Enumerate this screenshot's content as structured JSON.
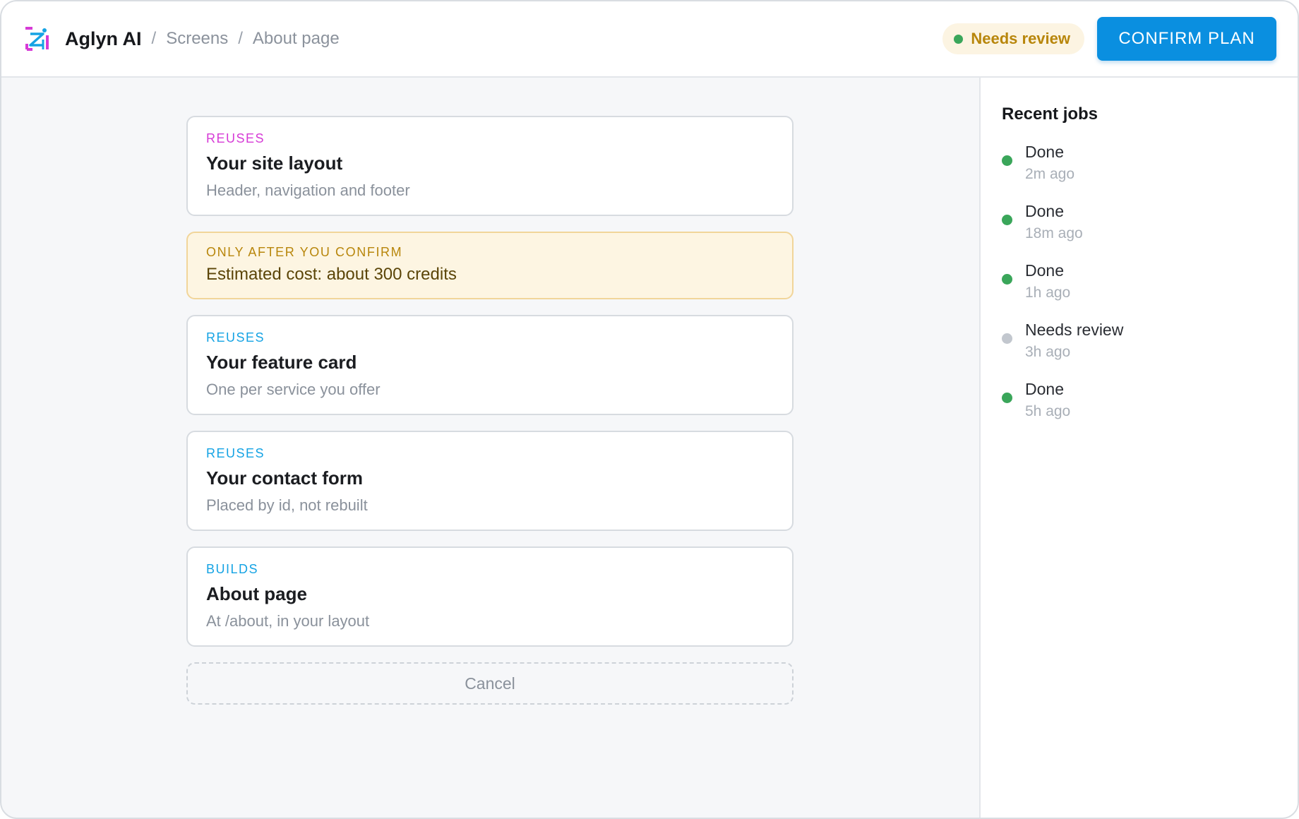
{
  "header": {
    "brand": "Aglyn AI",
    "breadcrumb": [
      {
        "label": "Screens"
      },
      {
        "label": "About page"
      }
    ],
    "separator": "/",
    "status": {
      "label": "Needs review",
      "dot_color": "#3aa65a"
    },
    "confirm_label": "CONFIRM PLAN",
    "accent": "#0a8fe0"
  },
  "cards": [
    {
      "tag": "REUSES",
      "title": "Your site layout",
      "subtitle": "Header, navigation and footer",
      "tag_color": "#d63bd6"
    },
    {
      "tag": "ONLY AFTER YOU CONFIRM",
      "text": "Estimated cost: about 300 credits"
    },
    {
      "tag": "REUSES",
      "title": "Your feature card",
      "subtitle": "One per service you offer",
      "tag_color": "#15a3e4"
    },
    {
      "tag": "REUSES",
      "title": "Your contact form",
      "subtitle": "Placed by id, not rebuilt",
      "tag_color": "#15a3e4"
    },
    {
      "tag": "BUILDS",
      "title": "About page",
      "subtitle": "At /about, in your layout",
      "tag_color": "#15a3e4"
    }
  ],
  "cancel_label": "Cancel",
  "sidebar": {
    "title": "Recent jobs",
    "jobs": [
      {
        "status": "Done",
        "time": "2m ago",
        "dot_color": "#3aa65a"
      },
      {
        "status": "Done",
        "time": "18m ago",
        "dot_color": "#3aa65a"
      },
      {
        "status": "Done",
        "time": "1h ago",
        "dot_color": "#3aa65a"
      },
      {
        "status": "Needs review",
        "time": "3h ago",
        "dot_color": "#c2c7ce"
      },
      {
        "status": "Done",
        "time": "5h ago",
        "dot_color": "#3aa65a"
      }
    ]
  }
}
